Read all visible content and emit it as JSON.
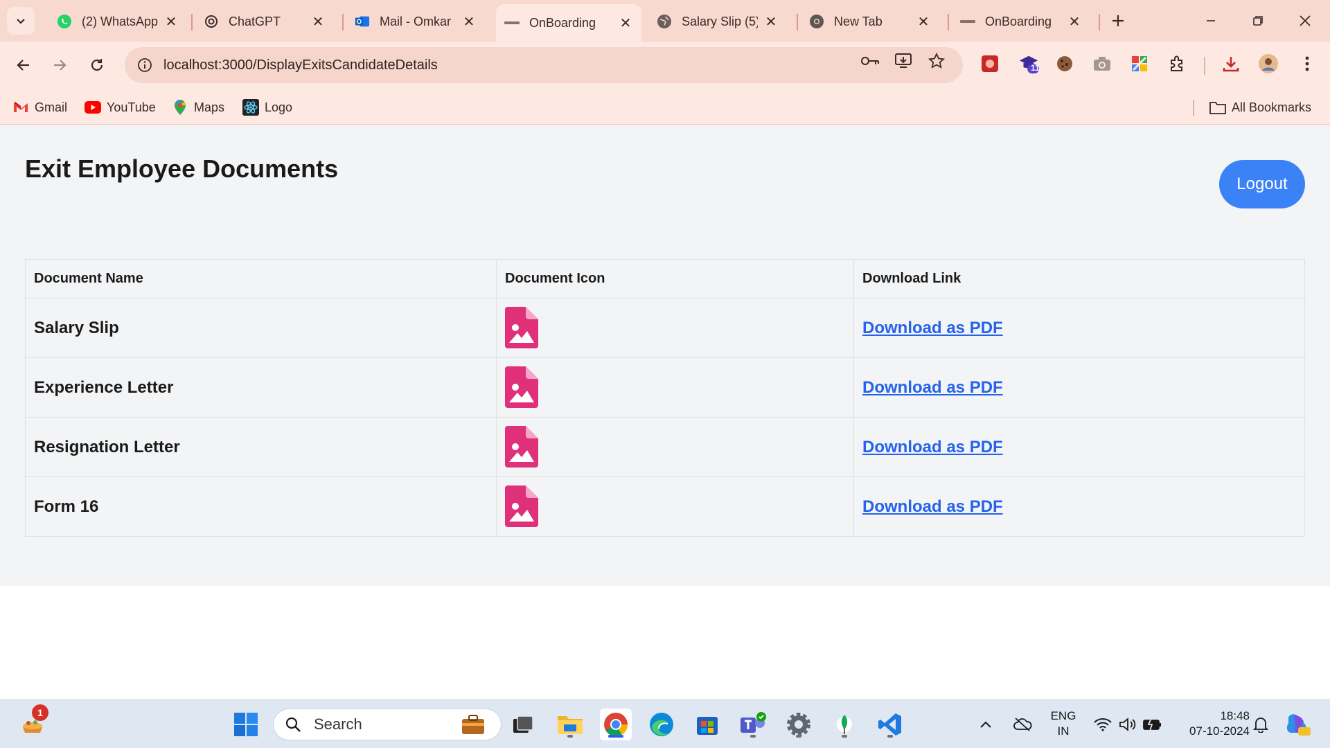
{
  "browser": {
    "tabs": [
      {
        "label": "(2) WhatsApp",
        "icon": "whatsapp-icon"
      },
      {
        "label": "ChatGPT",
        "icon": "chatgpt-icon"
      },
      {
        "label": "Mail - Omkar",
        "icon": "outlook-icon"
      },
      {
        "label": "OnBoarding",
        "icon": "site-icon",
        "active": true
      },
      {
        "label": "Salary Slip (5)",
        "icon": "globe-icon"
      },
      {
        "label": "New Tab",
        "icon": "chrome-icon"
      },
      {
        "label": "OnBoarding",
        "icon": "site-icon"
      }
    ],
    "url": "localhost:3000/DisplayExitsCandidateDetails",
    "bookmarks": [
      {
        "label": "Gmail",
        "icon": "gmail-icon"
      },
      {
        "label": "YouTube",
        "icon": "youtube-icon"
      },
      {
        "label": "Maps",
        "icon": "maps-icon"
      },
      {
        "label": "Logo",
        "icon": "react-icon"
      }
    ],
    "all_bookmarks": "All Bookmarks",
    "extension_badge": "11"
  },
  "page": {
    "title": "Exit Employee Documents",
    "logout_label": "Logout",
    "table": {
      "headers": [
        "Document Name",
        "Document Icon",
        "Download Link"
      ],
      "rows": [
        {
          "name": "Salary Slip",
          "link": "Download as PDF"
        },
        {
          "name": "Experience Letter",
          "link": "Download as PDF"
        },
        {
          "name": "Resignation Letter",
          "link": "Download as PDF"
        },
        {
          "name": "Form 16",
          "link": "Download as PDF"
        }
      ]
    },
    "icon_color": "#e0307a",
    "link_color": "#2563eb",
    "button_color": "#3b82f6"
  },
  "taskbar": {
    "search_placeholder": "Search",
    "notification_count": "1",
    "language_line1": "ENG",
    "language_line2": "IN",
    "time": "18:48",
    "date": "07-10-2024"
  }
}
